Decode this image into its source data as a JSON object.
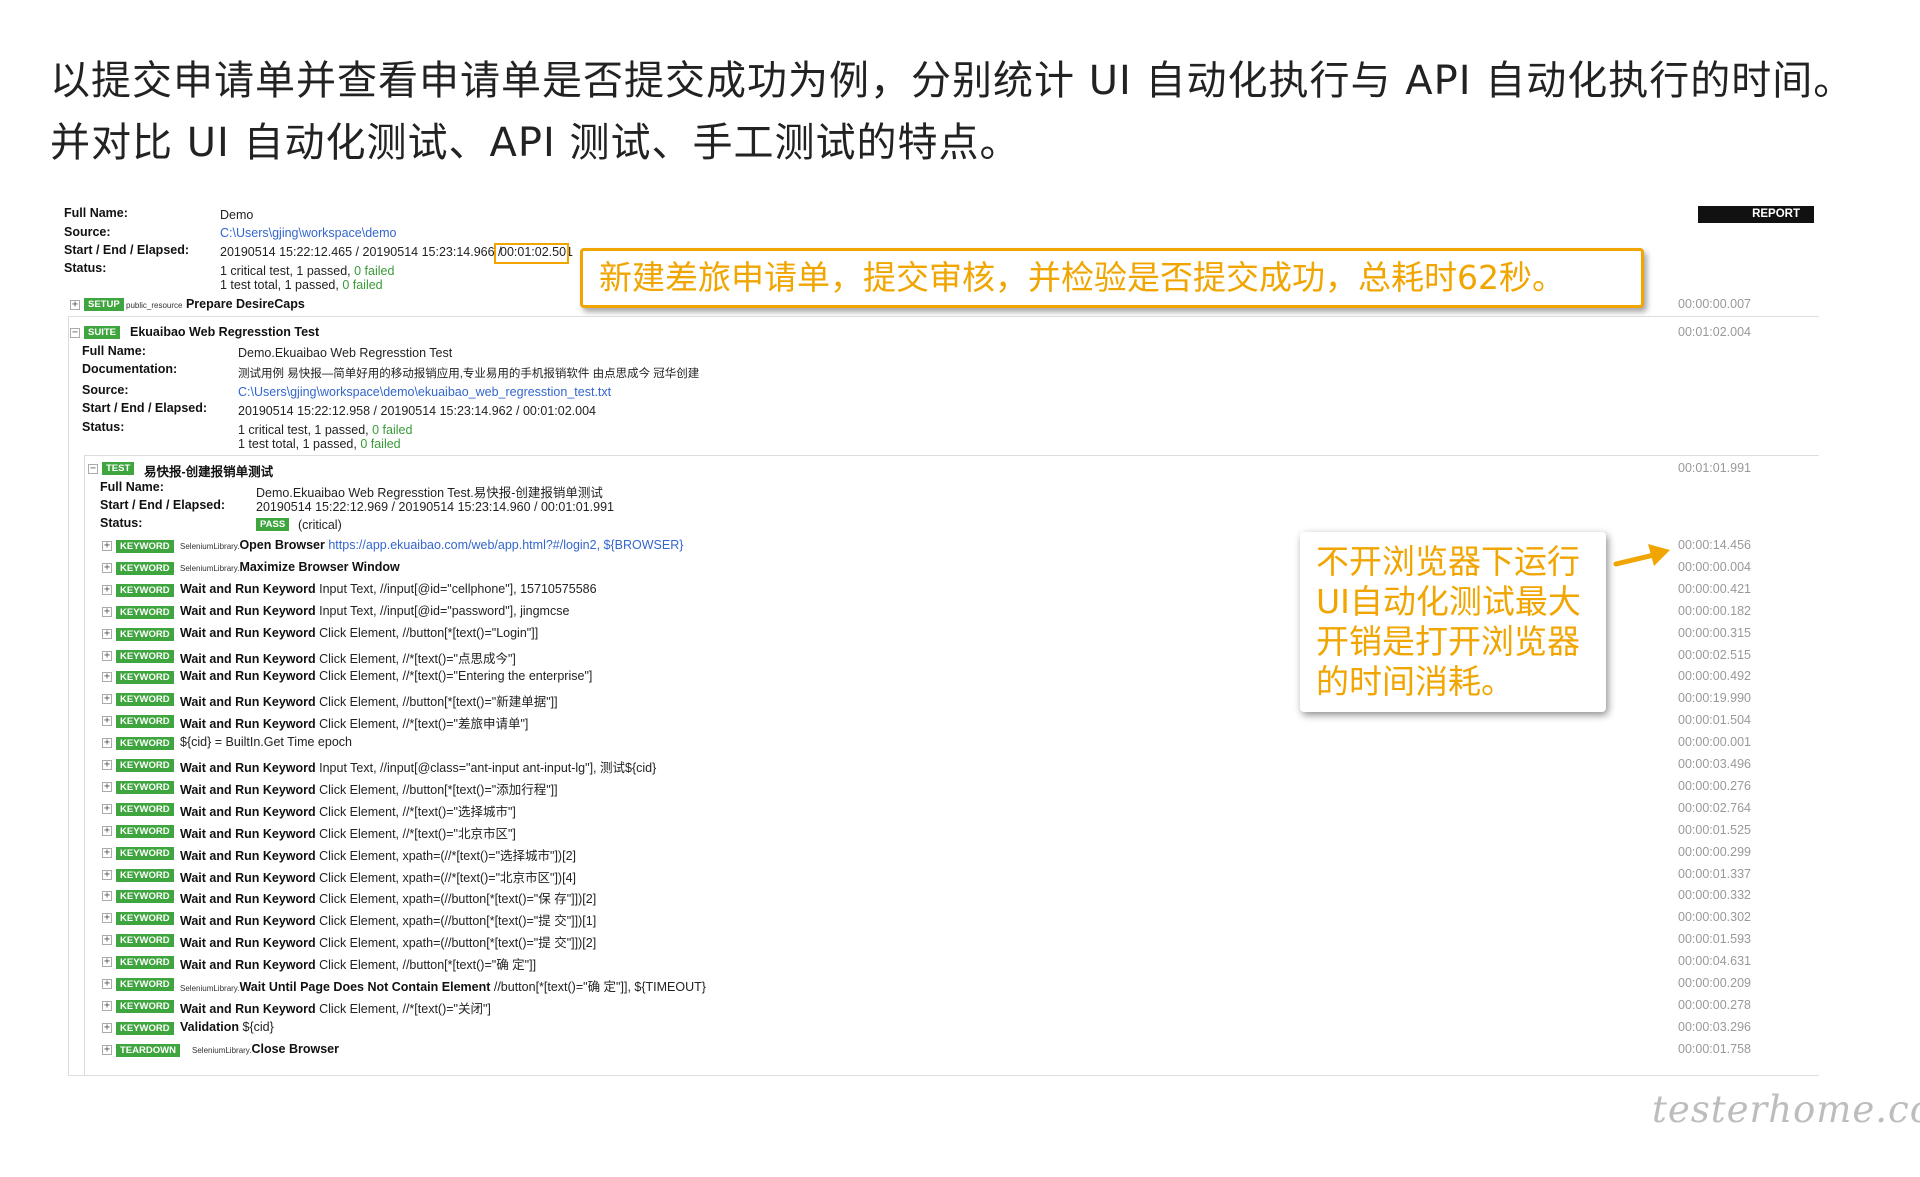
{
  "heading": {
    "line1": "以提交申请单并查看申请单是否提交成功为例，分别统计 UI 自动化执行与 API 自动化执行的时间。",
    "line2": "并对比 UI 自动化测试、API 测试、手工测试的特点。"
  },
  "report": {
    "tab_label": "REPORT",
    "labels": {
      "full_name": "Full Name:",
      "source": "Source:",
      "start_end": "Start / End / Elapsed:",
      "status": "Status:",
      "documentation": "Documentation:"
    },
    "top": {
      "full_name": "Demo",
      "source": "C:\\Users\\gjing\\workspace\\demo",
      "start_end": "20190514 15:22:12.465 / 20190514 15:23:14.966 /",
      "elapsed": "00:01:02.501",
      "status_1a": "1 critical test, 1 passed,",
      "status_1b": "0 failed",
      "status_2a": "1 test total, 1 passed,",
      "status_2b": "0 failed"
    },
    "setup": {
      "tag": "SETUP",
      "lib": "public_resource",
      "name": "Prepare DesireCaps",
      "time": "00:00:00.007"
    },
    "suite": {
      "tag": "SUITE",
      "name": "Ekuaibao Web Regresstion Test",
      "time": "00:01:02.004",
      "full_name": "Demo.Ekuaibao Web Regresstion Test",
      "documentation": "测试用例 易快报—简单好用的移动报销应用,专业易用的手机报销软件 由点思成今 冠华创建",
      "source": "C:\\Users\\gjing\\workspace\\demo\\ekuaibao_web_regresstion_test.txt",
      "start_end": "20190514 15:22:12.958 / 20190514 15:23:14.962 / 00:01:02.004",
      "status_1a": "1 critical test, 1 passed,",
      "status_1b": "0 failed",
      "status_2a": "1 test total, 1 passed,",
      "status_2b": "0 failed"
    },
    "test": {
      "tag": "TEST",
      "name": "易快报-创建报销单测试",
      "time": "00:01:01.991",
      "full_name": "Demo.Ekuaibao Web Regresstion Test.易快报-创建报销单测试",
      "start_end": "20190514 15:22:12.969 / 20190514 15:23:14.960 / 00:01:01.991",
      "status_badge": "PASS",
      "status_note": "(critical)"
    },
    "keywords": [
      {
        "tag": "KEYWORD",
        "lib": "SeleniumLibrary.",
        "name": "Open Browser",
        "args": "https://app.ekuaibao.com/web/app.html?#/login2, ${BROWSER}",
        "time": "00:00:14.456",
        "link": true
      },
      {
        "tag": "KEYWORD",
        "lib": "SeleniumLibrary.",
        "name": "Maximize Browser Window",
        "args": "",
        "time": "00:00:00.004"
      },
      {
        "tag": "KEYWORD",
        "lib": "",
        "name": "Wait and Run Keyword",
        "args": "Input Text, //input[@id=\"cellphone\"], 15710575586",
        "time": "00:00:00.421"
      },
      {
        "tag": "KEYWORD",
        "lib": "",
        "name": "Wait and Run Keyword",
        "args": "Input Text, //input[@id=\"password\"], jingmcse",
        "time": "00:00:00.182"
      },
      {
        "tag": "KEYWORD",
        "lib": "",
        "name": "Wait and Run Keyword",
        "args": "Click Element, //button[*[text()=\"Login\"]]",
        "time": "00:00:00.315"
      },
      {
        "tag": "KEYWORD",
        "lib": "",
        "name": "Wait and Run Keyword",
        "args": "Click Element, //*[text()=\"点思成今\"]",
        "time": "00:00:02.515"
      },
      {
        "tag": "KEYWORD",
        "lib": "",
        "name": "Wait and Run Keyword",
        "args": "Click Element, //*[text()=\"Entering the enterprise\"]",
        "time": "00:00:00.492"
      },
      {
        "tag": "KEYWORD",
        "lib": "",
        "name": "Wait and Run Keyword",
        "args": "Click Element, //button[*[text()=\"新建单据\"]]",
        "time": "00:00:19.990"
      },
      {
        "tag": "KEYWORD",
        "lib": "",
        "name": "Wait and Run Keyword",
        "args": "Click Element, //*[text()=\"差旅申请单\"]",
        "time": "00:00:01.504"
      },
      {
        "tag": "KEYWORD",
        "lib": "",
        "name": "${cid} = BuiltIn.Get Time",
        "args": "epoch",
        "time": "00:00:00.001",
        "plain": true
      },
      {
        "tag": "KEYWORD",
        "lib": "",
        "name": "Wait and Run Keyword",
        "args": "Input Text, //input[@class=\"ant-input ant-input-lg\"], 测试${cid}",
        "time": "00:00:03.496"
      },
      {
        "tag": "KEYWORD",
        "lib": "",
        "name": "Wait and Run Keyword",
        "args": "Click Element, //button[*[text()=\"添加行程\"]]",
        "time": "00:00:00.276"
      },
      {
        "tag": "KEYWORD",
        "lib": "",
        "name": "Wait and Run Keyword",
        "args": "Click Element, //*[text()=\"选择城市\"]",
        "time": "00:00:02.764"
      },
      {
        "tag": "KEYWORD",
        "lib": "",
        "name": "Wait and Run Keyword",
        "args": "Click Element, //*[text()=\"北京市区\"]",
        "time": "00:00:01.525"
      },
      {
        "tag": "KEYWORD",
        "lib": "",
        "name": "Wait and Run Keyword",
        "args": "Click Element, xpath=(//*[text()=\"选择城市\"])[2]",
        "time": "00:00:00.299"
      },
      {
        "tag": "KEYWORD",
        "lib": "",
        "name": "Wait and Run Keyword",
        "args": "Click Element, xpath=(//*[text()=\"北京市区\"])[4]",
        "time": "00:00:01.337"
      },
      {
        "tag": "KEYWORD",
        "lib": "",
        "name": "Wait and Run Keyword",
        "args": "Click Element, xpath=(//button[*[text()=\"保 存\"]])[2]",
        "time": "00:00:00.332"
      },
      {
        "tag": "KEYWORD",
        "lib": "",
        "name": "Wait and Run Keyword",
        "args": "Click Element, xpath=(//button[*[text()=\"提 交\"]])[1]",
        "time": "00:00:00.302"
      },
      {
        "tag": "KEYWORD",
        "lib": "",
        "name": "Wait and Run Keyword",
        "args": "Click Element, xpath=(//button[*[text()=\"提 交\"]])[2]",
        "time": "00:00:01.593"
      },
      {
        "tag": "KEYWORD",
        "lib": "",
        "name": "Wait and Run Keyword",
        "args": "Click Element, //button[*[text()=\"确 定\"]]",
        "time": "00:00:04.631"
      },
      {
        "tag": "KEYWORD",
        "lib": "SeleniumLibrary.",
        "name": "Wait Until Page Does Not Contain Element",
        "args": "//button[*[text()=\"确 定\"]], ${TIMEOUT}",
        "time": "00:00:00.209"
      },
      {
        "tag": "KEYWORD",
        "lib": "",
        "name": "Wait and Run Keyword",
        "args": "Click Element, //*[text()=\"关闭\"]",
        "time": "00:00:00.278"
      },
      {
        "tag": "KEYWORD",
        "lib": "",
        "name": "Validation",
        "args": "${cid}",
        "time": "00:00:03.296"
      },
      {
        "tag": "TEARDOWN",
        "lib": "SeleniumLibrary.",
        "name": "Close Browser",
        "args": "",
        "time": "00:00:01.758"
      }
    ]
  },
  "callouts": {
    "total_time": "新建差旅申请单，提交审核，并检验是否提交成功，总耗时62秒。",
    "browser_line1": "不开浏览器下运行",
    "browser_line2": "UI自动化测试最大",
    "browser_line3": "开销是打开浏览器",
    "browser_line4": "的时间消耗。"
  },
  "watermark": "testerhome.com",
  "colors": {
    "accent": "#f0a500",
    "tag_green": "#3fa63f",
    "link": "#3366cc"
  }
}
